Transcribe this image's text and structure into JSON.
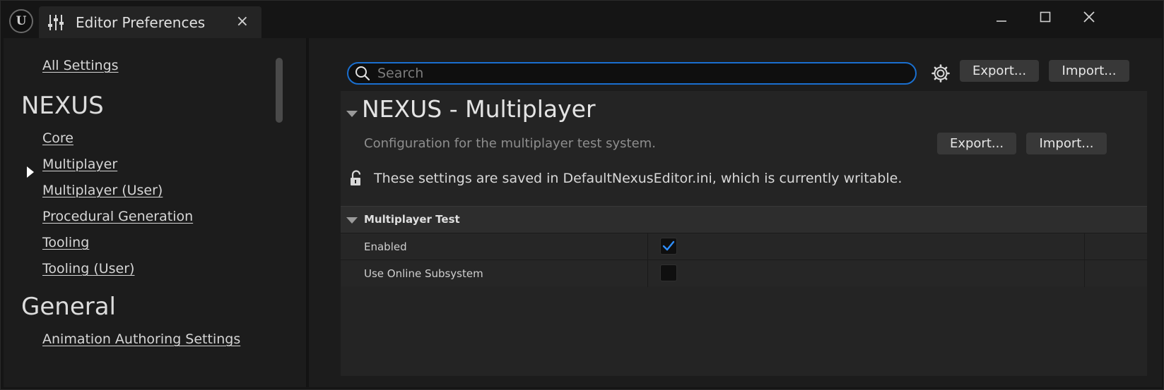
{
  "titlebar": {
    "logo_text": "U",
    "icon": "sliders-icon",
    "tab_title": "Editor Preferences",
    "close_glyph": "×",
    "window_controls": [
      "minimize-icon",
      "maximize-icon",
      "close-icon"
    ]
  },
  "sidebar": {
    "all_settings": "All Settings",
    "categories": [
      {
        "title": "NEXUS",
        "items": [
          "Core",
          "Multiplayer",
          "Multiplayer (User)",
          "Procedural Generation",
          "Tooling",
          "Tooling (User)"
        ]
      },
      {
        "title": "General",
        "items": [
          "Animation Authoring Settings"
        ]
      }
    ],
    "selected_item": "Multiplayer"
  },
  "toolbar": {
    "search_placeholder": "Search",
    "search_value": "",
    "export_label": "Export...",
    "import_label": "Import..."
  },
  "section": {
    "title": "NEXUS - Multiplayer",
    "description": "Configuration for the multiplayer test system.",
    "export_label": "Export...",
    "import_label": "Import...",
    "config_note": "These settings are saved in DefaultNexusEditor.ini, which is currently writable.",
    "groups": [
      {
        "title": "Multiplayer Test",
        "properties": [
          {
            "label": "Enabled",
            "checked": true
          },
          {
            "label": "Use Online Subsystem",
            "checked": false
          }
        ]
      }
    ]
  },
  "colors": {
    "accent": "#1a6fcf",
    "check": "#2f8fff",
    "background": "#151515",
    "panel": "#1c1c1c"
  }
}
